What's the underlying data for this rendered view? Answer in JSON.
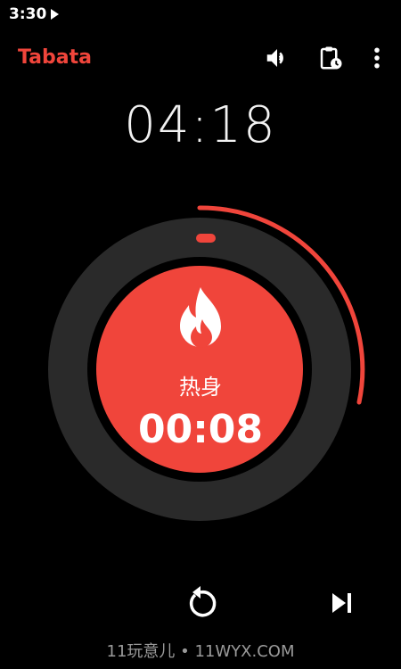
{
  "status_bar": {
    "time": "3:30",
    "media_icon": "play-icon"
  },
  "app_bar": {
    "title": "Tabata",
    "actions": [
      "volume-icon",
      "clipboard-clock-icon",
      "more-vert-icon"
    ]
  },
  "timer": {
    "total_time": "04:18",
    "phase_name": "热身",
    "phase_countdown": "00:08",
    "phase_icon": "flame-icon"
  },
  "controls": {
    "restart_icon": "restart-icon",
    "skip_icon": "skip-next-icon"
  },
  "watermark": "11玩意儿 • 11WYX.COM",
  "colors": {
    "accent": "#f0453b",
    "ring_dark": "#2a2a2a",
    "background": "#000000",
    "text": "#ffffff"
  }
}
